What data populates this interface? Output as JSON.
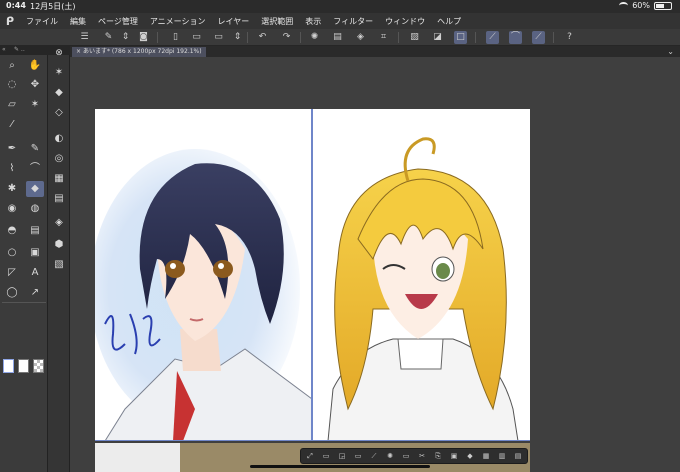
{
  "status_bar": {
    "time": "0:44",
    "date": "12月5日(土)",
    "battery": "60%",
    "battery_level": 0.6
  },
  "menu": {
    "logo": "ᑭ",
    "items": [
      "ファイル",
      "編集",
      "ページ管理",
      "アニメーション",
      "レイヤー",
      "選択範囲",
      "表示",
      "フィルター",
      "ウィンドウ",
      "ヘルプ"
    ]
  },
  "document": {
    "tab_title": "あいます* (786 x 1200px 72dpi 192.1%)"
  },
  "colors": {
    "accent": "#5e6a8e",
    "frame_border": "#6f86c9",
    "background": "#2f2f2f"
  },
  "toolbar_icons": [
    "menu-icon",
    "new-page-icon",
    "up-down-icon",
    "clip-logo-icon",
    "new-file-icon",
    "open-folder-icon",
    "save-icon",
    "up-down-icon",
    "undo-icon",
    "redo-icon",
    "loading-icon",
    "fill-icon",
    "transform-icon",
    "clear-icon",
    "crop-icon",
    "select-icon",
    "select-invert-icon",
    "select-frame-icon",
    "pen-pressure-icon",
    "brush-pressure-icon",
    "eraser-pressure-icon",
    "help-icon"
  ],
  "tools": {
    "main": [
      {
        "name": "zoom-icon",
        "glyph": "⌕"
      },
      {
        "name": "hand-icon",
        "glyph": "✋"
      },
      {
        "name": "lasso-icon",
        "glyph": "◌"
      },
      {
        "name": "move-icon",
        "glyph": "✥"
      },
      {
        "name": "eraser-icon",
        "glyph": "▱"
      },
      {
        "name": "magic-wand-icon",
        "glyph": "✶"
      },
      {
        "name": "eyedropper-icon",
        "glyph": "⁄"
      },
      {
        "name": "pen-icon",
        "glyph": "✒"
      },
      {
        "name": "pencil-icon",
        "glyph": "✎"
      },
      {
        "name": "brush-icon",
        "glyph": "⌇"
      },
      {
        "name": "marker-icon",
        "glyph": "⌒"
      },
      {
        "name": "airbrush-icon",
        "glyph": "✱"
      },
      {
        "name": "eraser-tool-icon",
        "glyph": "◆"
      },
      {
        "name": "blend-icon",
        "glyph": "◉"
      },
      {
        "name": "smudge-icon",
        "glyph": "◍"
      },
      {
        "name": "fill-bucket-icon",
        "glyph": "◓"
      },
      {
        "name": "gradient-icon",
        "glyph": "▤"
      },
      {
        "name": "shape-icon",
        "glyph": "○"
      },
      {
        "name": "frame-icon",
        "glyph": "▣"
      },
      {
        "name": "ruler-icon",
        "glyph": "◸"
      },
      {
        "name": "text-icon",
        "glyph": "A"
      },
      {
        "name": "balloon-icon",
        "glyph": "◯"
      },
      {
        "name": "correct-line-icon",
        "glyph": "↗"
      }
    ],
    "sub": [
      {
        "name": "sub-tool-icon-1",
        "glyph": "✶"
      },
      {
        "name": "sub-tool-icon-2",
        "glyph": "◆"
      },
      {
        "name": "sub-tool-icon-3",
        "glyph": "◇"
      },
      {
        "name": "sub-tool-icon-4",
        "glyph": "◐"
      },
      {
        "name": "sub-tool-icon-5",
        "glyph": "◎"
      },
      {
        "name": "sub-tool-icon-6",
        "glyph": "▦"
      },
      {
        "name": "sub-tool-icon-7",
        "glyph": "▤"
      },
      {
        "name": "sub-tool-icon-8",
        "glyph": "◈"
      },
      {
        "name": "sub-tool-icon-9",
        "glyph": "⬢"
      },
      {
        "name": "sub-tool-icon-10",
        "glyph": "▧"
      }
    ]
  },
  "bottom_toolbar_icons": [
    "deselect-icon",
    "invert-icon",
    "expand-icon",
    "transform-icon",
    "scale-icon",
    "settings-icon",
    "cut-icon",
    "copy-icon",
    "paste-icon",
    "fill-icon",
    "canvas-icon",
    "copy-layer-icon",
    "duplicate-icon",
    "more-icon"
  ]
}
